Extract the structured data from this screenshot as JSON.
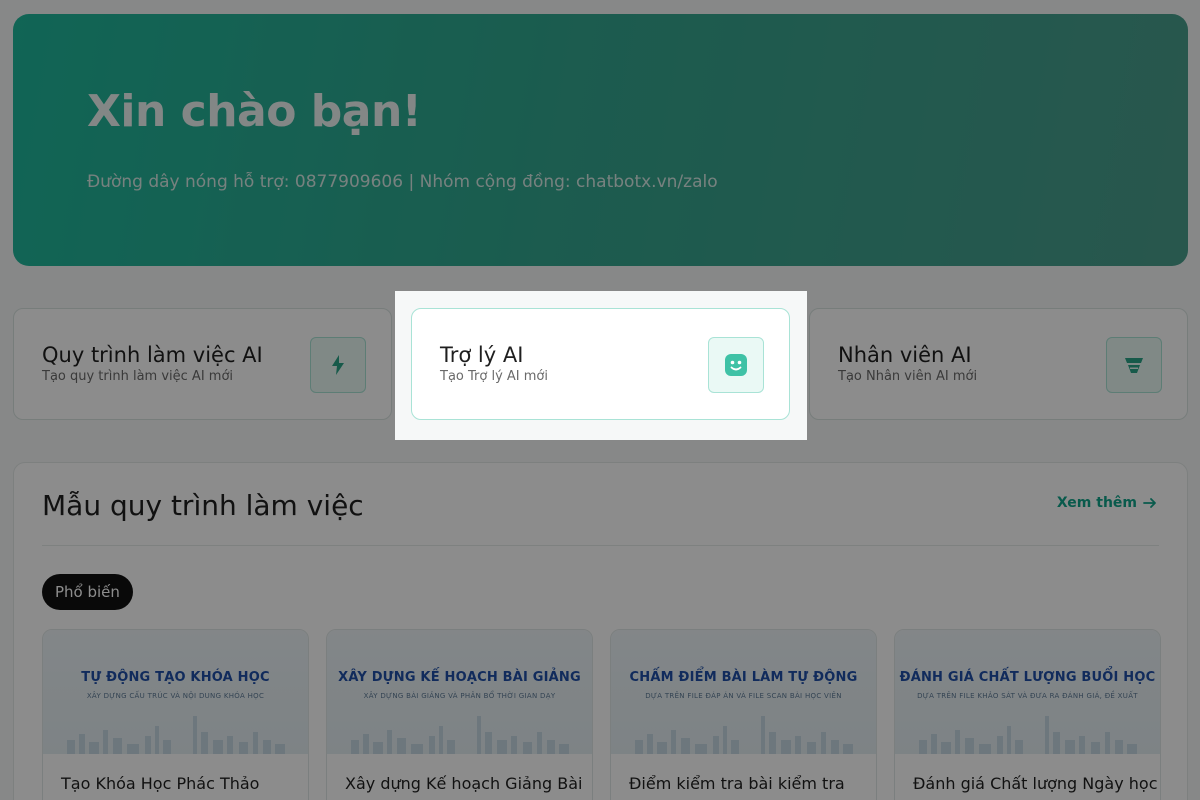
{
  "hero": {
    "title": "Xin chào bạn!",
    "subtitle": "Đường dây nóng hỗ trợ: 0877909606 | Nhóm cộng đồng: chatbotx.vn/zalo"
  },
  "create_cards": [
    {
      "title": "Quy trình làm việc AI",
      "subtitle": "Tạo quy trình làm việc AI mới",
      "icon": "lightning-icon"
    },
    {
      "title": "Trợ lý AI",
      "subtitle": "Tạo Trợ lý AI mới",
      "icon": "robot-face-icon"
    },
    {
      "title": "Nhân viên AI",
      "subtitle": "Tạo Nhân viên AI mới",
      "icon": "agent-icon"
    }
  ],
  "templates_section": {
    "title": "Mẫu quy trình làm việc",
    "see_more": "Xem thêm",
    "filter_pill": "Phổ biến",
    "items": [
      {
        "banner_title": "TỰ ĐỘNG TẠO KHÓA HỌC",
        "banner_sub": "XÂY DỰNG CẤU TRÚC VÀ NỘI DUNG KHÓA HỌC",
        "name": "Tạo Khóa Học Phác Thảo"
      },
      {
        "banner_title": "XÂY DỰNG KẾ HOẠCH BÀI GIẢNG",
        "banner_sub": "XÂY DỰNG BÀI GIẢNG VÀ PHÂN BỔ THỜI GIAN DẠY",
        "name": "Xây dựng Kế hoạch Giảng Bài"
      },
      {
        "banner_title": "CHẤM ĐIỂM BÀI LÀM TỰ ĐỘNG",
        "banner_sub": "DỰA TRÊN FILE ĐÁP ÁN VÀ FILE SCAN BÀI HỌC VIÊN",
        "name": "Điểm kiểm tra bài kiểm tra"
      },
      {
        "banner_title": "ĐÁNH GIÁ CHẤT LƯỢNG BUỔI HỌC",
        "banner_sub": "DỰA TRÊN FILE KHẢO SÁT VÀ ĐƯA RA ĐÁNH GIÁ, ĐỀ XUẤT",
        "name": "Đánh giá Chất lượng Ngày học"
      }
    ]
  },
  "colors": {
    "accent": "#12a58a",
    "hero_start": "#1fb89c",
    "hero_end": "#4a9e8d",
    "overlay": "rgba(0,0,0,0.45)"
  }
}
